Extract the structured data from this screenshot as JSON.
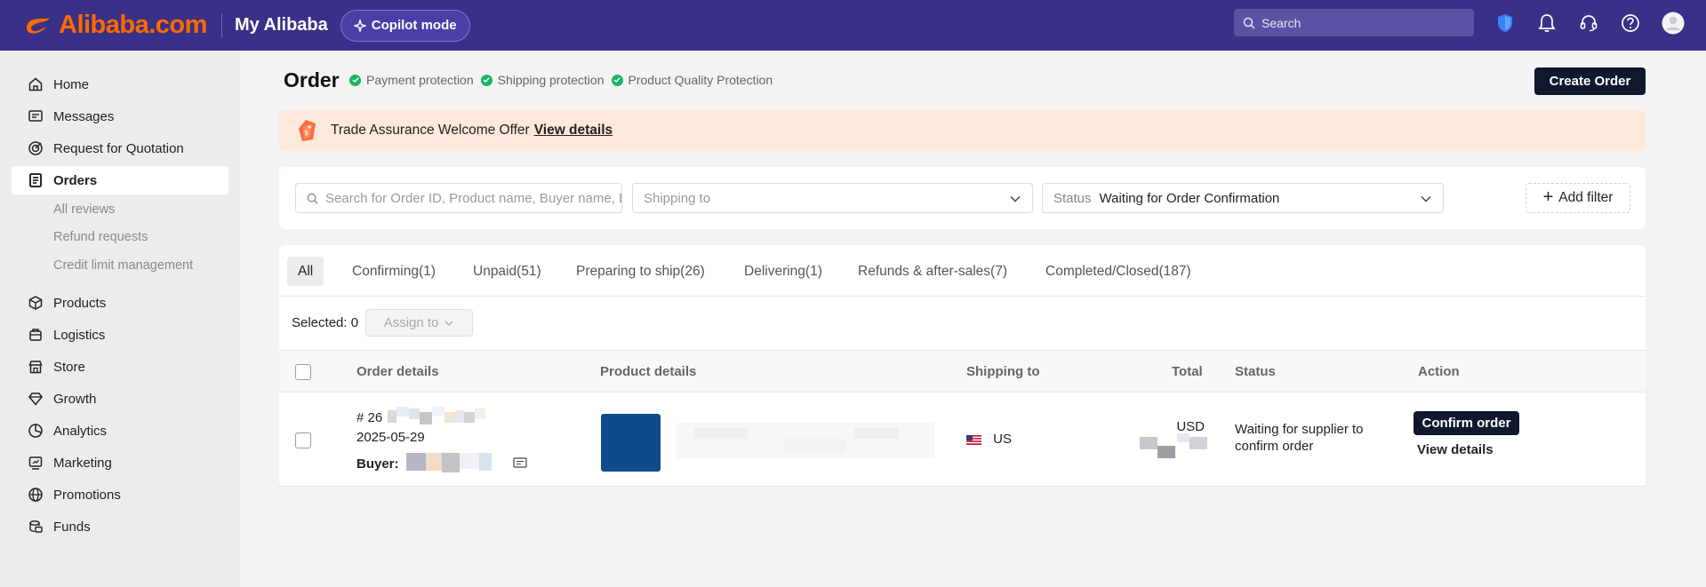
{
  "header": {
    "logo_text": "Alibaba.com",
    "title": "My Alibaba",
    "copilot_label": "Copilot mode",
    "search_placeholder": "Search",
    "accent": "#3a3087",
    "brand": "#ff6a00",
    "icons": [
      "shield-icon",
      "bell-icon",
      "headset-icon",
      "help-icon",
      "avatar"
    ]
  },
  "sidebar": {
    "items": [
      {
        "label": "Home",
        "icon": "home-icon"
      },
      {
        "label": "Messages",
        "icon": "message-icon"
      },
      {
        "label": "Request for Quotation",
        "icon": "target-icon"
      },
      {
        "label": "Orders",
        "icon": "orders-icon",
        "active": true
      },
      {
        "label": "Products",
        "icon": "box-icon"
      },
      {
        "label": "Logistics",
        "icon": "truck-icon"
      },
      {
        "label": "Store",
        "icon": "store-icon"
      },
      {
        "label": "Growth",
        "icon": "diamond-icon"
      },
      {
        "label": "Analytics",
        "icon": "pie-icon"
      },
      {
        "label": "Marketing",
        "icon": "marketing-icon"
      },
      {
        "label": "Promotions",
        "icon": "globe-icon"
      },
      {
        "label": "Funds",
        "icon": "coins-icon"
      }
    ],
    "sub_items": [
      "All reviews",
      "Refund requests",
      "Credit limit management"
    ]
  },
  "page": {
    "title": "Order",
    "badges": [
      "Payment protection",
      "Shipping protection",
      "Product Quality Protection"
    ],
    "create_order_label": "Create Order"
  },
  "offer": {
    "text": "Trade Assurance Welcome Offer",
    "link": "View details"
  },
  "filters": {
    "search_placeholder": "Search for Order ID, Product name, Buyer name, Buyer ...",
    "shipping_placeholder": "Shipping to",
    "status_label": "Status",
    "status_value": "Waiting for Order Confirmation",
    "add_filter_label": "Add filter"
  },
  "tabs": [
    "All",
    "Confirming(1)",
    "Unpaid(51)",
    "Preparing to ship(26)",
    "Delivering(1)",
    "Refunds & after-sales(7)",
    "Completed/Closed(187)"
  ],
  "selection": {
    "label": "Selected: 0",
    "assign_label": "Assign to"
  },
  "table": {
    "columns": [
      "Order details",
      "Product details",
      "Shipping to",
      "Total",
      "Status",
      "Action"
    ],
    "rows": [
      {
        "order_id_prefix": "# 26",
        "date": "2025-05-29",
        "buyer_label": "Buyer:",
        "shipping_to": "US",
        "total_currency": "USD",
        "status": "Waiting for supplier to confirm order",
        "action_primary": "Confirm order",
        "action_secondary": "View details"
      }
    ]
  }
}
